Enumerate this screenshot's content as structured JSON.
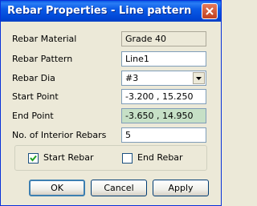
{
  "window": {
    "title": "Rebar Properties - Line pattern"
  },
  "form": {
    "rebar_material": {
      "label": "Rebar Material",
      "value": "Grade 40"
    },
    "rebar_pattern": {
      "label": "Rebar Pattern",
      "value": "Line1"
    },
    "rebar_dia": {
      "label": "Rebar Dia",
      "value": "#3"
    },
    "start_point": {
      "label": "Start Point",
      "value": "-3.200 , 15.250"
    },
    "end_point": {
      "label": "End Point",
      "value": "-3.650 , 14.950"
    },
    "interior_rebars": {
      "label": "No. of Interior Rebars",
      "value": "5"
    }
  },
  "options": {
    "start_rebar": {
      "label": "Start Rebar",
      "checked": true
    },
    "end_rebar": {
      "label": "End Rebar",
      "checked": false
    }
  },
  "buttons": {
    "ok": "OK",
    "cancel": "Cancel",
    "apply": "Apply"
  },
  "colors": {
    "titlebar": "#0a5ae6",
    "dialog_bg": "#ece9d8",
    "end_point_bg": "#c6e0c6"
  }
}
